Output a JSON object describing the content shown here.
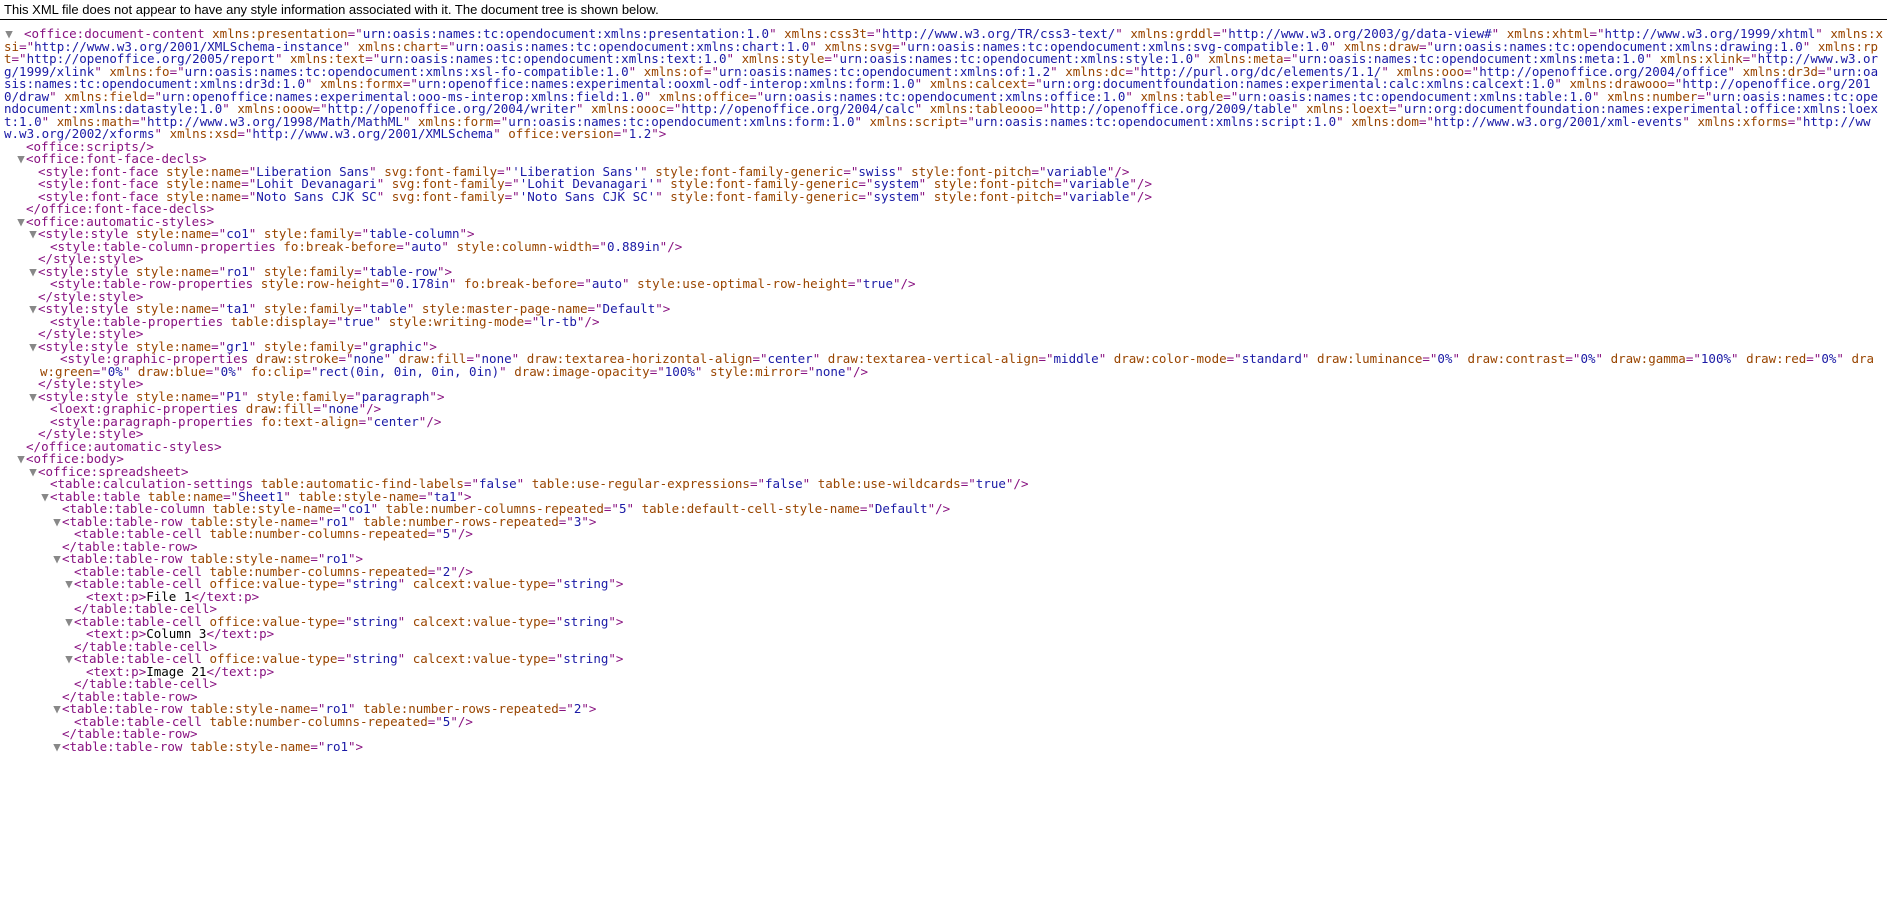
{
  "header": {
    "message": "This XML file does not appear to have any style information associated with it. The document tree is shown below."
  },
  "root": {
    "tag": "office:document-content",
    "attrs": [
      {
        "n": "xmlns:presentation",
        "v": "urn:oasis:names:tc:opendocument:xmlns:presentation:1.0"
      },
      {
        "n": "xmlns:css3t",
        "v": "http://www.w3.org/TR/css3-text/"
      },
      {
        "n": "xmlns:grddl",
        "v": "http://www.w3.org/2003/g/data-view#"
      },
      {
        "n": "xmlns:xhtml",
        "v": "http://www.w3.org/1999/xhtml"
      },
      {
        "n": "xmlns:xsi",
        "v": "http://www.w3.org/2001/XMLSchema-instance"
      },
      {
        "n": "xmlns:chart",
        "v": "urn:oasis:names:tc:opendocument:xmlns:chart:1.0"
      },
      {
        "n": "xmlns:svg",
        "v": "urn:oasis:names:tc:opendocument:xmlns:svg-compatible:1.0"
      },
      {
        "n": "xmlns:draw",
        "v": "urn:oasis:names:tc:opendocument:xmlns:drawing:1.0"
      },
      {
        "n": "xmlns:rpt",
        "v": "http://openoffice.org/2005/report"
      },
      {
        "n": "xmlns:text",
        "v": "urn:oasis:names:tc:opendocument:xmlns:text:1.0"
      },
      {
        "n": "xmlns:style",
        "v": "urn:oasis:names:tc:opendocument:xmlns:style:1.0"
      },
      {
        "n": "xmlns:meta",
        "v": "urn:oasis:names:tc:opendocument:xmlns:meta:1.0"
      },
      {
        "n": "xmlns:xlink",
        "v": "http://www.w3.org/1999/xlink"
      },
      {
        "n": "xmlns:fo",
        "v": "urn:oasis:names:tc:opendocument:xmlns:xsl-fo-compatible:1.0"
      },
      {
        "n": "xmlns:of",
        "v": "urn:oasis:names:tc:opendocument:xmlns:of:1.2"
      },
      {
        "n": "xmlns:dc",
        "v": "http://purl.org/dc/elements/1.1/"
      },
      {
        "n": "xmlns:ooo",
        "v": "http://openoffice.org/2004/office"
      },
      {
        "n": "xmlns:dr3d",
        "v": "urn:oasis:names:tc:opendocument:xmlns:dr3d:1.0"
      },
      {
        "n": "xmlns:formx",
        "v": "urn:openoffice:names:experimental:ooxml-odf-interop:xmlns:form:1.0"
      },
      {
        "n": "xmlns:calcext",
        "v": "urn:org:documentfoundation:names:experimental:calc:xmlns:calcext:1.0"
      },
      {
        "n": "xmlns:drawooo",
        "v": "http://openoffice.org/2010/draw"
      },
      {
        "n": "xmlns:field",
        "v": "urn:openoffice:names:experimental:ooo-ms-interop:xmlns:field:1.0"
      },
      {
        "n": "xmlns:office",
        "v": "urn:oasis:names:tc:opendocument:xmlns:office:1.0"
      },
      {
        "n": "xmlns:table",
        "v": "urn:oasis:names:tc:opendocument:xmlns:table:1.0"
      },
      {
        "n": "xmlns:number",
        "v": "urn:oasis:names:tc:opendocument:xmlns:datastyle:1.0"
      },
      {
        "n": "xmlns:ooow",
        "v": "http://openoffice.org/2004/writer"
      },
      {
        "n": "xmlns:oooc",
        "v": "http://openoffice.org/2004/calc"
      },
      {
        "n": "xmlns:tableooo",
        "v": "http://openoffice.org/2009/table"
      },
      {
        "n": "xmlns:loext",
        "v": "urn:org:documentfoundation:names:experimental:office:xmlns:loext:1.0"
      },
      {
        "n": "xmlns:math",
        "v": "http://www.w3.org/1998/Math/MathML"
      },
      {
        "n": "xmlns:form",
        "v": "urn:oasis:names:tc:opendocument:xmlns:form:1.0"
      },
      {
        "n": "xmlns:script",
        "v": "urn:oasis:names:tc:opendocument:xmlns:script:1.0"
      },
      {
        "n": "xmlns:dom",
        "v": "http://www.w3.org/2001/xml-events"
      },
      {
        "n": "xmlns:xforms",
        "v": "http://www.w3.org/2002/xforms"
      },
      {
        "n": "xmlns:xsd",
        "v": "http://www.w3.org/2001/XMLSchema"
      },
      {
        "n": "office:version",
        "v": "1.2"
      }
    ]
  },
  "lines": [
    {
      "ind": 1,
      "toggle": " ",
      "self": true,
      "tag": "office:scripts",
      "attrs": []
    },
    {
      "ind": 1,
      "toggle": "▼",
      "tag": "office:font-face-decls",
      "attrs": []
    },
    {
      "ind": 2,
      "toggle": " ",
      "self": true,
      "tag": "style:font-face",
      "attrs": [
        {
          "n": "style:name",
          "v": "Liberation Sans"
        },
        {
          "n": "svg:font-family",
          "v": "'Liberation Sans'"
        },
        {
          "n": "style:font-family-generic",
          "v": "swiss"
        },
        {
          "n": "style:font-pitch",
          "v": "variable"
        }
      ]
    },
    {
      "ind": 2,
      "toggle": " ",
      "self": true,
      "tag": "style:font-face",
      "attrs": [
        {
          "n": "style:name",
          "v": "Lohit Devanagari"
        },
        {
          "n": "svg:font-family",
          "v": "'Lohit Devanagari'"
        },
        {
          "n": "style:font-family-generic",
          "v": "system"
        },
        {
          "n": "style:font-pitch",
          "v": "variable"
        }
      ]
    },
    {
      "ind": 2,
      "toggle": " ",
      "self": true,
      "tag": "style:font-face",
      "attrs": [
        {
          "n": "style:name",
          "v": "Noto Sans CJK SC"
        },
        {
          "n": "svg:font-family",
          "v": "'Noto Sans CJK SC'"
        },
        {
          "n": "style:font-family-generic",
          "v": "system"
        },
        {
          "n": "style:font-pitch",
          "v": "variable"
        }
      ]
    },
    {
      "ind": 1,
      "toggle": " ",
      "close": true,
      "tag": "office:font-face-decls"
    },
    {
      "ind": 1,
      "toggle": "▼",
      "tag": "office:automatic-styles",
      "attrs": []
    },
    {
      "ind": 2,
      "toggle": "▼",
      "tag": "style:style",
      "attrs": [
        {
          "n": "style:name",
          "v": "co1"
        },
        {
          "n": "style:family",
          "v": "table-column"
        }
      ]
    },
    {
      "ind": 3,
      "toggle": " ",
      "self": true,
      "tag": "style:table-column-properties",
      "attrs": [
        {
          "n": "fo:break-before",
          "v": "auto"
        },
        {
          "n": "style:column-width",
          "v": "0.889in"
        }
      ]
    },
    {
      "ind": 2,
      "toggle": " ",
      "close": true,
      "tag": "style:style"
    },
    {
      "ind": 2,
      "toggle": "▼",
      "tag": "style:style",
      "attrs": [
        {
          "n": "style:name",
          "v": "ro1"
        },
        {
          "n": "style:family",
          "v": "table-row"
        }
      ]
    },
    {
      "ind": 3,
      "toggle": " ",
      "self": true,
      "tag": "style:table-row-properties",
      "attrs": [
        {
          "n": "style:row-height",
          "v": "0.178in"
        },
        {
          "n": "fo:break-before",
          "v": "auto"
        },
        {
          "n": "style:use-optimal-row-height",
          "v": "true"
        }
      ]
    },
    {
      "ind": 2,
      "toggle": " ",
      "close": true,
      "tag": "style:style"
    },
    {
      "ind": 2,
      "toggle": "▼",
      "tag": "style:style",
      "attrs": [
        {
          "n": "style:name",
          "v": "ta1"
        },
        {
          "n": "style:family",
          "v": "table"
        },
        {
          "n": "style:master-page-name",
          "v": "Default"
        }
      ]
    },
    {
      "ind": 3,
      "toggle": " ",
      "self": true,
      "tag": "style:table-properties",
      "attrs": [
        {
          "n": "table:display",
          "v": "true"
        },
        {
          "n": "style:writing-mode",
          "v": "lr-tb"
        }
      ]
    },
    {
      "ind": 2,
      "toggle": " ",
      "close": true,
      "tag": "style:style"
    },
    {
      "ind": 2,
      "toggle": "▼",
      "tag": "style:style",
      "attrs": [
        {
          "n": "style:name",
          "v": "gr1"
        },
        {
          "n": "style:family",
          "v": "graphic"
        }
      ]
    },
    {
      "ind": 3,
      "toggle": " ",
      "self": true,
      "wrap": true,
      "tag": "style:graphic-properties",
      "attrs": [
        {
          "n": "draw:stroke",
          "v": "none"
        },
        {
          "n": "draw:fill",
          "v": "none"
        },
        {
          "n": "draw:textarea-horizontal-align",
          "v": "center"
        },
        {
          "n": "draw:textarea-vertical-align",
          "v": "middle"
        },
        {
          "n": "draw:color-mode",
          "v": "standard"
        },
        {
          "n": "draw:luminance",
          "v": "0%"
        },
        {
          "n": "draw:contrast",
          "v": "0%"
        },
        {
          "n": "draw:gamma",
          "v": "100%"
        },
        {
          "n": "draw:red",
          "v": "0%"
        },
        {
          "n": "draw:green",
          "v": "0%"
        },
        {
          "n": "draw:blue",
          "v": "0%"
        },
        {
          "n": "fo:clip",
          "v": "rect(0in, 0in, 0in, 0in)"
        },
        {
          "n": "draw:image-opacity",
          "v": "100%"
        },
        {
          "n": "style:mirror",
          "v": "none"
        }
      ]
    },
    {
      "ind": 2,
      "toggle": " ",
      "close": true,
      "tag": "style:style"
    },
    {
      "ind": 2,
      "toggle": "▼",
      "tag": "style:style",
      "attrs": [
        {
          "n": "style:name",
          "v": "P1"
        },
        {
          "n": "style:family",
          "v": "paragraph"
        }
      ]
    },
    {
      "ind": 3,
      "toggle": " ",
      "self": true,
      "tag": "loext:graphic-properties",
      "attrs": [
        {
          "n": "draw:fill",
          "v": "none"
        }
      ]
    },
    {
      "ind": 3,
      "toggle": " ",
      "self": true,
      "tag": "style:paragraph-properties",
      "attrs": [
        {
          "n": "fo:text-align",
          "v": "center"
        }
      ]
    },
    {
      "ind": 2,
      "toggle": " ",
      "close": true,
      "tag": "style:style"
    },
    {
      "ind": 1,
      "toggle": " ",
      "close": true,
      "tag": "office:automatic-styles"
    },
    {
      "ind": 1,
      "toggle": "▼",
      "tag": "office:body",
      "attrs": []
    },
    {
      "ind": 2,
      "toggle": "▼",
      "tag": "office:spreadsheet",
      "attrs": []
    },
    {
      "ind": 3,
      "toggle": " ",
      "self": true,
      "tag": "table:calculation-settings",
      "attrs": [
        {
          "n": "table:automatic-find-labels",
          "v": "false"
        },
        {
          "n": "table:use-regular-expressions",
          "v": "false"
        },
        {
          "n": "table:use-wildcards",
          "v": "true"
        }
      ]
    },
    {
      "ind": 3,
      "toggle": "▼",
      "tag": "table:table",
      "attrs": [
        {
          "n": "table:name",
          "v": "Sheet1"
        },
        {
          "n": "table:style-name",
          "v": "ta1"
        }
      ]
    },
    {
      "ind": 4,
      "toggle": " ",
      "self": true,
      "tag": "table:table-column",
      "attrs": [
        {
          "n": "table:style-name",
          "v": "co1"
        },
        {
          "n": "table:number-columns-repeated",
          "v": "5"
        },
        {
          "n": "table:default-cell-style-name",
          "v": "Default"
        }
      ]
    },
    {
      "ind": 4,
      "toggle": "▼",
      "tag": "table:table-row",
      "attrs": [
        {
          "n": "table:style-name",
          "v": "ro1"
        },
        {
          "n": "table:number-rows-repeated",
          "v": "3"
        }
      ]
    },
    {
      "ind": 5,
      "toggle": " ",
      "self": true,
      "tag": "table:table-cell",
      "attrs": [
        {
          "n": "table:number-columns-repeated",
          "v": "5"
        }
      ]
    },
    {
      "ind": 4,
      "toggle": " ",
      "close": true,
      "tag": "table:table-row"
    },
    {
      "ind": 4,
      "toggle": "▼",
      "tag": "table:table-row",
      "attrs": [
        {
          "n": "table:style-name",
          "v": "ro1"
        }
      ]
    },
    {
      "ind": 5,
      "toggle": " ",
      "self": true,
      "tag": "table:table-cell",
      "attrs": [
        {
          "n": "table:number-columns-repeated",
          "v": "2"
        }
      ]
    },
    {
      "ind": 5,
      "toggle": "▼",
      "tag": "table:table-cell",
      "attrs": [
        {
          "n": "office:value-type",
          "v": "string"
        },
        {
          "n": "calcext:value-type",
          "v": "string"
        }
      ]
    },
    {
      "ind": 6,
      "toggle": " ",
      "inline": true,
      "tag": "text:p",
      "text": "File 1"
    },
    {
      "ind": 5,
      "toggle": " ",
      "close": true,
      "tag": "table:table-cell"
    },
    {
      "ind": 5,
      "toggle": "▼",
      "tag": "table:table-cell",
      "attrs": [
        {
          "n": "office:value-type",
          "v": "string"
        },
        {
          "n": "calcext:value-type",
          "v": "string"
        }
      ]
    },
    {
      "ind": 6,
      "toggle": " ",
      "inline": true,
      "tag": "text:p",
      "text": "Column 3"
    },
    {
      "ind": 5,
      "toggle": " ",
      "close": true,
      "tag": "table:table-cell"
    },
    {
      "ind": 5,
      "toggle": "▼",
      "tag": "table:table-cell",
      "attrs": [
        {
          "n": "office:value-type",
          "v": "string"
        },
        {
          "n": "calcext:value-type",
          "v": "string"
        }
      ]
    },
    {
      "ind": 6,
      "toggle": " ",
      "inline": true,
      "tag": "text:p",
      "text": "Image 21"
    },
    {
      "ind": 5,
      "toggle": " ",
      "close": true,
      "tag": "table:table-cell"
    },
    {
      "ind": 4,
      "toggle": " ",
      "close": true,
      "tag": "table:table-row"
    },
    {
      "ind": 4,
      "toggle": "▼",
      "tag": "table:table-row",
      "attrs": [
        {
          "n": "table:style-name",
          "v": "ro1"
        },
        {
          "n": "table:number-rows-repeated",
          "v": "2"
        }
      ]
    },
    {
      "ind": 5,
      "toggle": " ",
      "self": true,
      "tag": "table:table-cell",
      "attrs": [
        {
          "n": "table:number-columns-repeated",
          "v": "5"
        }
      ]
    },
    {
      "ind": 4,
      "toggle": " ",
      "close": true,
      "tag": "table:table-row"
    },
    {
      "ind": 4,
      "toggle": "▼",
      "tag": "table:table-row",
      "attrs": [
        {
          "n": "table:style-name",
          "v": "ro1"
        }
      ]
    }
  ]
}
